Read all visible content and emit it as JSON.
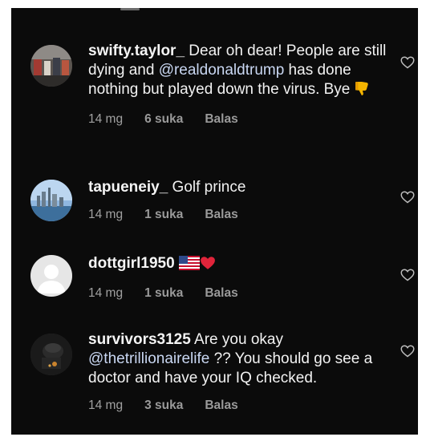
{
  "colors": {
    "background": "#0b0b0b",
    "text": "#f2f2f2",
    "muted": "#9a9a9a",
    "mention": "#c9d7f2",
    "heart_outline": "#bdbdbd"
  },
  "comments": [
    {
      "username": "swifty.taylor_",
      "text_1": " Dear oh dear! People are still dying and ",
      "mention": "@realdonaldtrump",
      "text_2": " has done nothing but played down the virus. Bye",
      "emoji": "thumbs-down-icon",
      "time": "14 mg",
      "likes": "6 suka",
      "reply": "Balas"
    },
    {
      "username": "tapueneiy_",
      "text_1": " Golf prince",
      "time": "14 mg",
      "likes": "1 suka",
      "reply": "Balas"
    },
    {
      "username": "dottgirl1950",
      "emoji_1": "us-flag-icon",
      "emoji_2": "red-heart-icon",
      "time": "14 mg",
      "likes": "1 suka",
      "reply": "Balas"
    },
    {
      "username": "survivors3125",
      "text_1": " Are you okay ",
      "mention": "@thetrillionairelife",
      "text_2": " ?? You should go see a doctor and have your IQ checked.",
      "time": "14 mg",
      "likes": "3 suka",
      "reply": "Balas"
    }
  ]
}
